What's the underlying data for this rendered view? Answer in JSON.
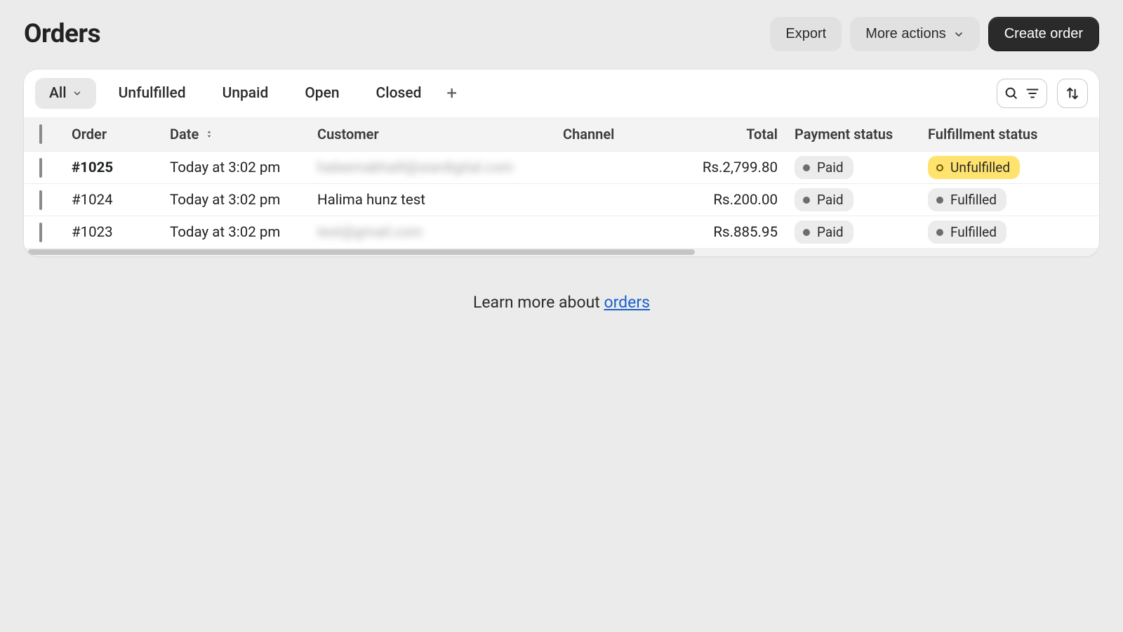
{
  "header": {
    "title": "Orders",
    "export": "Export",
    "moreActions": "More actions",
    "create": "Create order"
  },
  "tabs": {
    "items": [
      {
        "label": "All",
        "active": true,
        "hasCaret": true
      },
      {
        "label": "Unfulfilled",
        "active": false,
        "hasCaret": false
      },
      {
        "label": "Unpaid",
        "active": false,
        "hasCaret": false
      },
      {
        "label": "Open",
        "active": false,
        "hasCaret": false
      },
      {
        "label": "Closed",
        "active": false,
        "hasCaret": false
      }
    ],
    "add": "+"
  },
  "columns": {
    "order": "Order",
    "date": "Date",
    "customer": "Customer",
    "channel": "Channel",
    "total": "Total",
    "payment": "Payment status",
    "fulfillment": "Fulfillment status"
  },
  "rows": [
    {
      "order": "#1025",
      "date": "Today at 3:02 pm",
      "customer": "haleemakhalil@siardigital.com",
      "customerBlurred": true,
      "channel": "",
      "total": "Rs.2,799.80",
      "payment": "Paid",
      "fulfillment": "Unfulfilled",
      "fulfillmentWarn": true,
      "boldOrder": true
    },
    {
      "order": "#1024",
      "date": "Today at 3:02 pm",
      "customer": "Halima hunz test",
      "customerBlurred": false,
      "channel": "",
      "total": "Rs.200.00",
      "payment": "Paid",
      "fulfillment": "Fulfilled",
      "fulfillmentWarn": false,
      "boldOrder": false
    },
    {
      "order": "#1023",
      "date": "Today at 3:02 pm",
      "customer": "test@gmail.com",
      "customerBlurred": true,
      "channel": "",
      "total": "Rs.885.95",
      "payment": "Paid",
      "fulfillment": "Fulfilled",
      "fulfillmentWarn": false,
      "boldOrder": false
    }
  ],
  "footer": {
    "prefix": "Learn more about ",
    "link": "orders"
  }
}
